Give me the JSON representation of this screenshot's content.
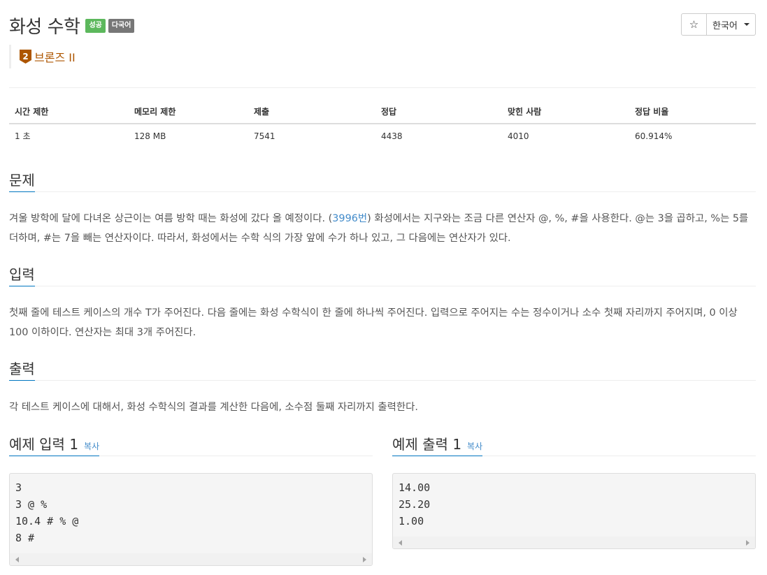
{
  "problem": {
    "title": "화성 수학",
    "badges": [
      "성공",
      "다국어"
    ],
    "tier_number": "2",
    "tier_label": "브론즈 II"
  },
  "toolbar": {
    "star": "☆",
    "language": "한국어"
  },
  "info_table": {
    "headers": [
      "시간 제한",
      "메모리 제한",
      "제출",
      "정답",
      "맞힌 사람",
      "정답 비율"
    ],
    "values": [
      "1 초",
      "128 MB",
      "7541",
      "4438",
      "4010",
      "60.914%"
    ]
  },
  "sections": {
    "problem_heading": "문제",
    "problem_text_1": "겨울 방학에 달에 다녀온 상근이는 여름 방학 때는 화성에 갔다 올 예정이다. (",
    "problem_link": "3996번",
    "problem_text_2": ") 화성에서는 지구와는 조금 다른 연산자 @, %, #을 사용한다. @는 3을 곱하고, %는 5를 더하며, #는 7을 빼는 연산자이다. 따라서, 화성에서는 수학 식의 가장 앞에 수가 하나 있고, 그 다음에는 연산자가 있다.",
    "input_heading": "입력",
    "input_text": "첫째 줄에 테스트 케이스의 개수 T가 주어진다. 다음 줄에는 화성 수학식이 한 줄에 하나씩 주어진다. 입력으로 주어지는 수는 정수이거나 소수 첫째 자리까지 주어지며, 0 이상 100 이하이다. 연산자는 최대 3개 주어진다.",
    "output_heading": "출력",
    "output_text": "각 테스트 케이스에 대해서, 화성 수학식의 결과를 계산한 다음에, 소수점 둘째 자리까지 출력한다."
  },
  "samples": {
    "input_heading": "예제 입력 1",
    "output_heading": "예제 출력 1",
    "copy_label": "복사",
    "input_lines": [
      "3",
      "3 @ %",
      "10.4 # % @",
      "8 #"
    ],
    "output_lines": [
      "14.00",
      "25.20",
      "1.00"
    ]
  }
}
